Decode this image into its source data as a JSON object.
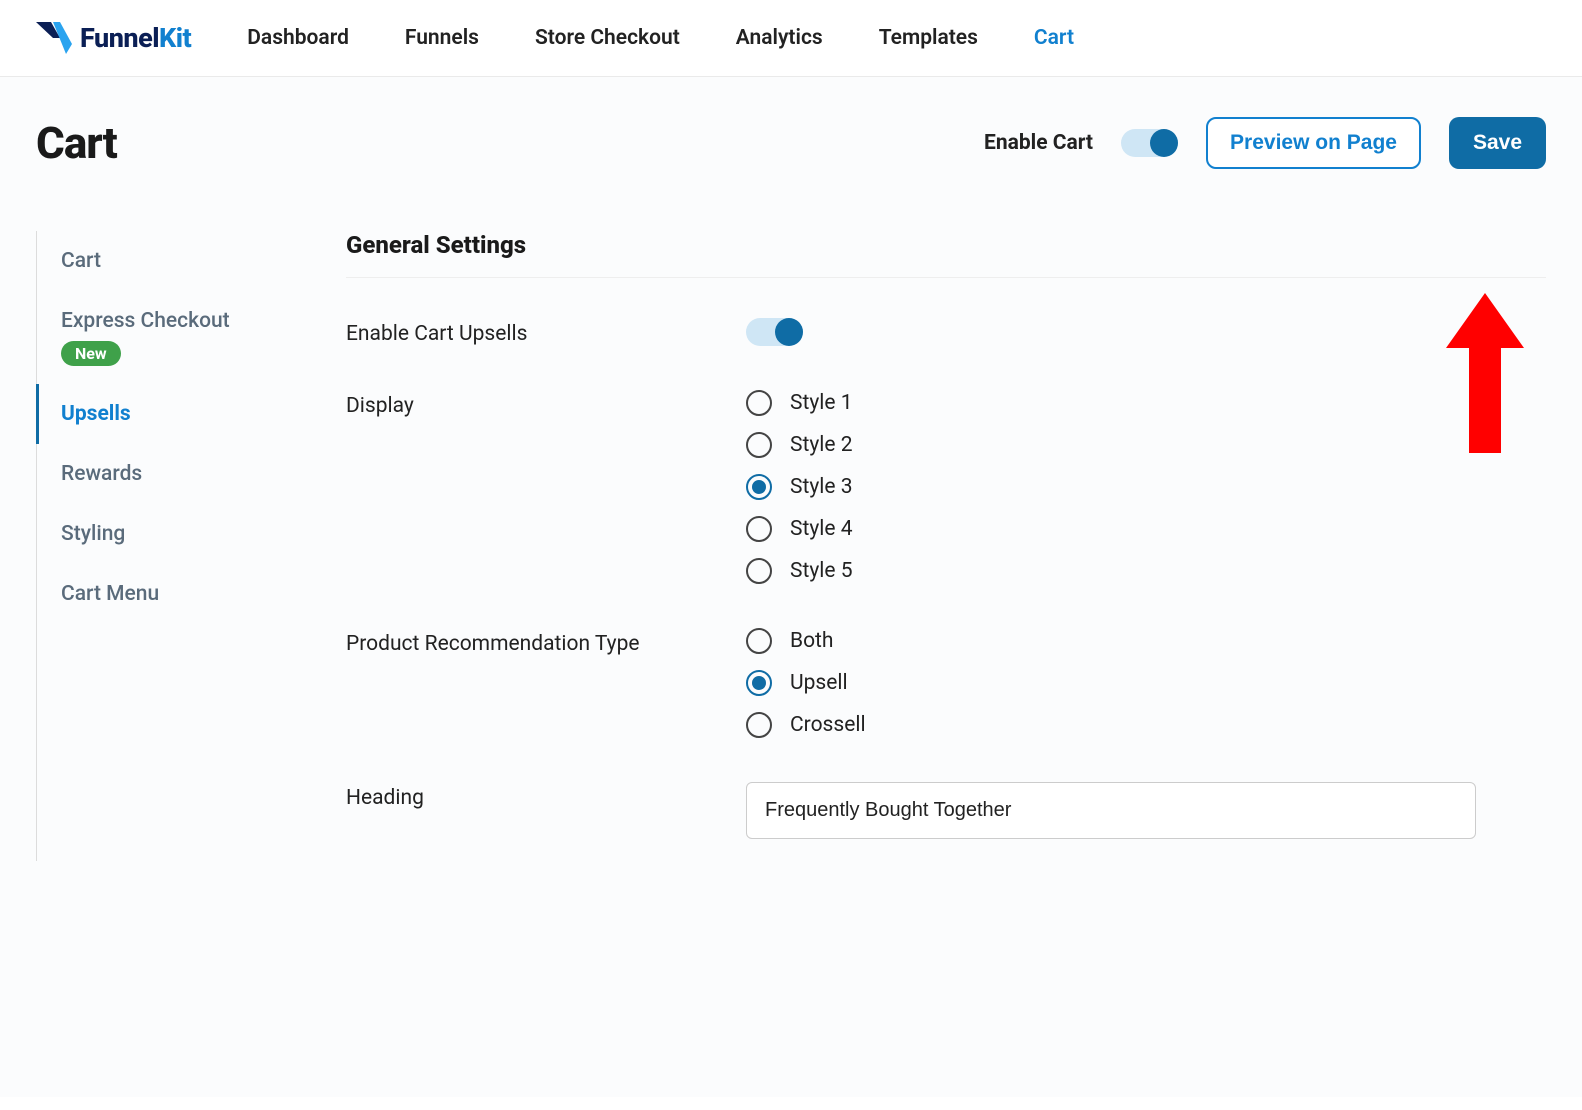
{
  "brand": {
    "name_main": "Funnel",
    "name_accent": "Kit"
  },
  "topnav": {
    "items": [
      {
        "label": "Dashboard",
        "active": false
      },
      {
        "label": "Funnels",
        "active": false
      },
      {
        "label": "Store Checkout",
        "active": false
      },
      {
        "label": "Analytics",
        "active": false
      },
      {
        "label": "Templates",
        "active": false
      },
      {
        "label": "Cart",
        "active": true
      }
    ]
  },
  "page": {
    "title": "Cart",
    "enable_label": "Enable Cart",
    "enable_value": true,
    "preview_label": "Preview on Page",
    "save_label": "Save"
  },
  "sidebar": {
    "items": [
      {
        "label": "Cart",
        "active": false
      },
      {
        "label": "Express Checkout",
        "active": false,
        "badge": "New"
      },
      {
        "label": "Upsells",
        "active": true
      },
      {
        "label": "Rewards",
        "active": false
      },
      {
        "label": "Styling",
        "active": false
      },
      {
        "label": "Cart Menu",
        "active": false
      }
    ]
  },
  "settings": {
    "section_title": "General Settings",
    "enable_upsells_label": "Enable Cart Upsells",
    "enable_upsells_value": true,
    "display_label": "Display",
    "display_options": [
      {
        "label": "Style 1",
        "checked": false
      },
      {
        "label": "Style 2",
        "checked": false
      },
      {
        "label": "Style 3",
        "checked": true
      },
      {
        "label": "Style 4",
        "checked": false
      },
      {
        "label": "Style 5",
        "checked": false
      }
    ],
    "rec_type_label": "Product Recommendation Type",
    "rec_type_options": [
      {
        "label": "Both",
        "checked": false
      },
      {
        "label": "Upsell",
        "checked": true
      },
      {
        "label": "Crossell",
        "checked": false
      }
    ],
    "heading_label": "Heading",
    "heading_value": "Frequently Bought Together"
  }
}
